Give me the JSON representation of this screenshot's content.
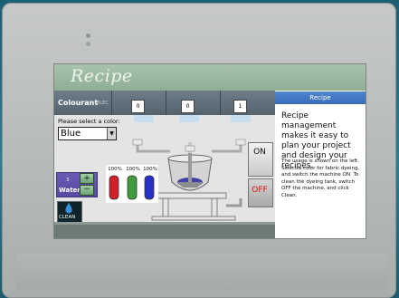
{
  "screen": {
    "title": "Recipe",
    "colour": {
      "label": "Colourant",
      "sub": "BLEC",
      "values": [
        "0",
        "0",
        "1"
      ]
    },
    "select_label": "Please select a color:",
    "selected_color": "Blue",
    "side_panel": {
      "heading": "Recipe",
      "intro": "Recipe management makes it easy to plan your project and design your recipes.",
      "detail": "The usage is shown on the left. Select a color for fabric dyeing, and switch the machine ON. To clean the dyeing tank, switch OFF the machine, and click Clean."
    },
    "water": {
      "count": "3",
      "label": "Water",
      "plus": "+",
      "minus": "−"
    },
    "clean_label": "CLEAN",
    "tubes": {
      "percents": [
        "100%",
        "100%",
        "100%"
      ],
      "fill_fraction": [
        1.0,
        1.0,
        1.0
      ]
    },
    "switch": {
      "on": "ON",
      "off": "OFF"
    }
  },
  "colors": {
    "title_bar": "#9bb7a1",
    "side_heading": "#4479c4",
    "tube_red": "#d0202a",
    "tube_green": "#3f9b3c",
    "tube_blue": "#2a2fc8",
    "dye_blue": "#3d3fa6"
  },
  "icons": [
    "water-drop-icon",
    "select-arrow-icon",
    "plus-icon",
    "minus-icon"
  ]
}
